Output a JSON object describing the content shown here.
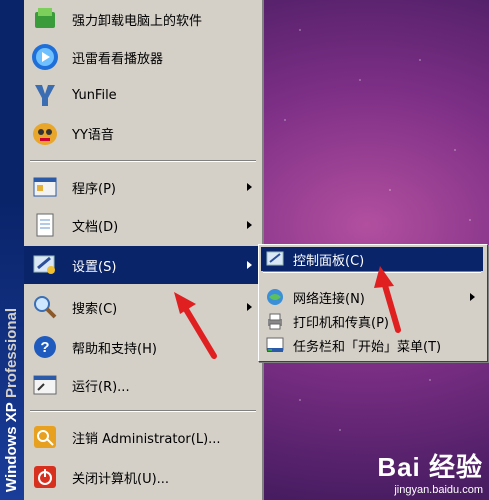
{
  "start_menu": {
    "sidebar_text": "Windows XP",
    "sidebar_text_pro": "Professional",
    "pinned": [
      {
        "label": "强力卸载电脑上的软件",
        "icon": "uninstall-icon"
      },
      {
        "label": "迅雷看看播放器",
        "icon": "xunlei-player-icon"
      },
      {
        "label": "YunFile",
        "icon": "yunfile-icon"
      },
      {
        "label": "YY语音",
        "icon": "yy-voice-icon"
      }
    ],
    "items": [
      {
        "label": "程序(P)",
        "icon": "programs-icon",
        "submenu": true
      },
      {
        "label": "文档(D)",
        "icon": "documents-icon",
        "submenu": true
      },
      {
        "label": "设置(S)",
        "icon": "settings-icon",
        "submenu": true
      },
      {
        "label": "搜索(C)",
        "icon": "search-icon",
        "submenu": true
      },
      {
        "label": "帮助和支持(H)",
        "icon": "help-icon",
        "submenu": false
      },
      {
        "label": "运行(R)...",
        "icon": "run-icon",
        "submenu": false
      }
    ],
    "bottom": [
      {
        "label": "注销 Administrator(L)...",
        "icon": "logoff-icon"
      },
      {
        "label": "关闭计算机(U)...",
        "icon": "shutdown-icon"
      }
    ]
  },
  "settings_submenu": {
    "items": [
      {
        "label": "控制面板(C)",
        "icon": "control-panel-icon"
      },
      {
        "label": "网络连接(N)",
        "icon": "network-icon",
        "submenu": true
      },
      {
        "label": "打印机和传真(P)",
        "icon": "printer-icon"
      },
      {
        "label": "任务栏和「开始」菜单(T)",
        "icon": "taskbar-icon"
      }
    ]
  },
  "watermark": {
    "logo": "Bai 经验",
    "url": "jingyan.baidu.com"
  },
  "colors": {
    "highlight": "#0a246a",
    "menu_bg": "#d4d0c8",
    "annotation_arrow": "#e02020"
  }
}
